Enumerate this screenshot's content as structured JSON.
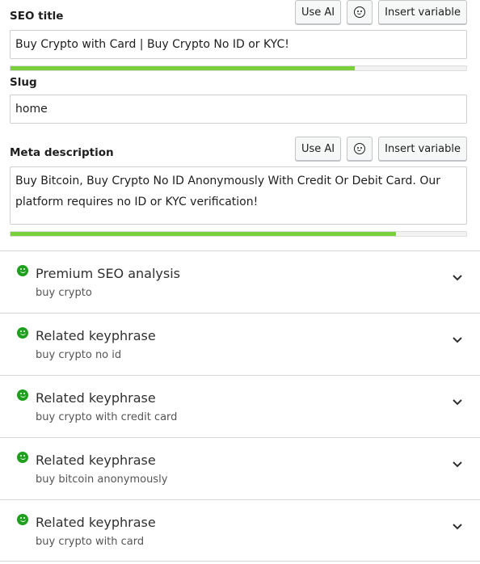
{
  "seo_title": {
    "label": "SEO title",
    "value": "Buy Crypto with Card | Buy Crypto No ID or KYC!",
    "progress": 0.755,
    "progress_color": "#7ad03a"
  },
  "slug": {
    "label": "Slug",
    "value": "home"
  },
  "meta_description": {
    "label": "Meta description",
    "value": "Buy Bitcoin, Buy Crypto No ID Anonymously With Credit Or Debit Card. Our platform requires no ID or KYC verification!",
    "progress": 0.845,
    "progress_color": "#7ad03a"
  },
  "buttons": {
    "use_ai": "Use AI",
    "insert_variable": "Insert variable",
    "emoji_icon": "smiley-icon"
  },
  "panels": [
    {
      "title": "Premium SEO analysis",
      "subtitle": "buy crypto",
      "status": "good",
      "status_color": "#1ea01e"
    },
    {
      "title": "Related keyphrase",
      "subtitle": "buy crypto no id",
      "status": "good",
      "status_color": "#1ea01e"
    },
    {
      "title": "Related keyphrase",
      "subtitle": "buy crypto with credit card",
      "status": "good",
      "status_color": "#1ea01e"
    },
    {
      "title": "Related keyphrase",
      "subtitle": "buy bitcoin anonymously",
      "status": "good",
      "status_color": "#1ea01e"
    },
    {
      "title": "Related keyphrase",
      "subtitle": "buy crypto with card",
      "status": "good",
      "status_color": "#1ea01e"
    }
  ]
}
